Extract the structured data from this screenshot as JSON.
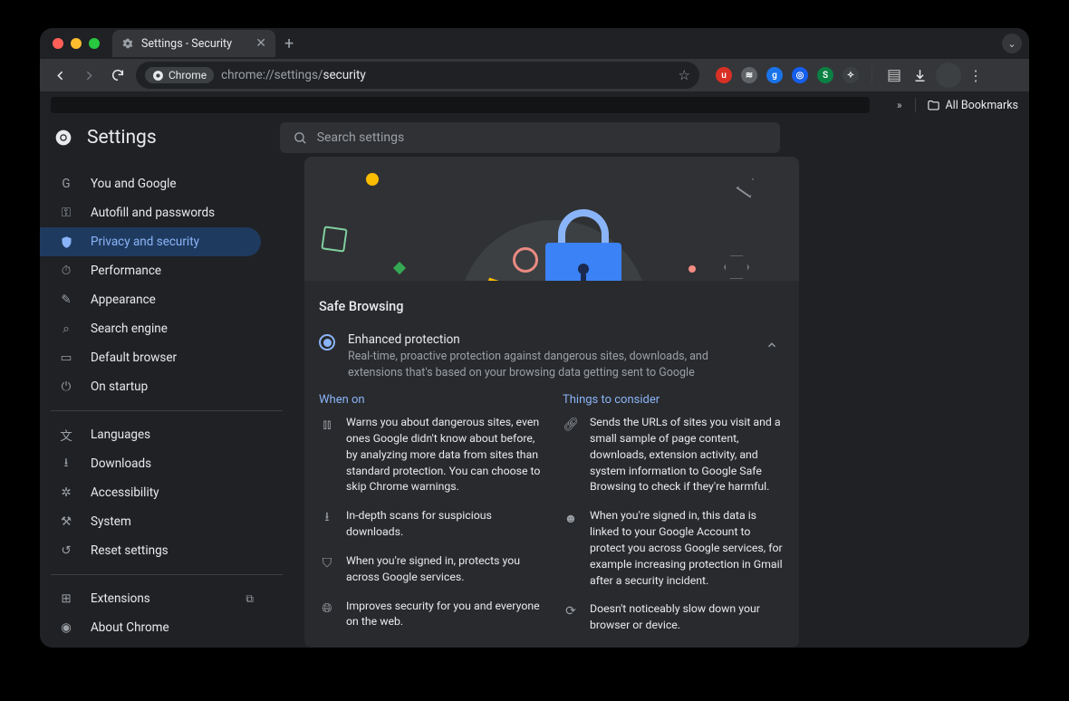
{
  "window": {
    "tab_title": "Settings - Security",
    "url_prefix": "chrome://settings/",
    "url_page": "security",
    "chip_label": "Chrome",
    "bookmarks_label": "All Bookmarks"
  },
  "header": {
    "title": "Settings",
    "search_placeholder": "Search settings"
  },
  "sidebar": {
    "items": [
      {
        "label": "You and Google",
        "icon": "user-icon"
      },
      {
        "label": "Autofill and passwords",
        "icon": "key-icon"
      },
      {
        "label": "Privacy and security",
        "icon": "shield-icon",
        "active": true
      },
      {
        "label": "Performance",
        "icon": "speedometer-icon"
      },
      {
        "label": "Appearance",
        "icon": "paint-icon"
      },
      {
        "label": "Search engine",
        "icon": "search-icon"
      },
      {
        "label": "Default browser",
        "icon": "window-icon"
      },
      {
        "label": "On startup",
        "icon": "power-icon"
      }
    ],
    "items2": [
      {
        "label": "Languages",
        "icon": "translate-icon"
      },
      {
        "label": "Downloads",
        "icon": "download-icon"
      },
      {
        "label": "Accessibility",
        "icon": "accessibility-icon"
      },
      {
        "label": "System",
        "icon": "system-icon"
      },
      {
        "label": "Reset settings",
        "icon": "reset-icon"
      }
    ],
    "items3": [
      {
        "label": "Extensions",
        "icon": "extension-icon",
        "external": true
      },
      {
        "label": "About Chrome",
        "icon": "chrome-icon"
      }
    ]
  },
  "main": {
    "section_title": "Safe Browsing",
    "option": {
      "title": "Enhanced protection",
      "desc": "Real-time, proactive protection against dangerous sites, downloads, and extensions that's based on your browsing data getting sent to Google"
    },
    "col_left_head": "When on",
    "col_right_head": "Things to consider",
    "left": [
      {
        "text": "Warns you about dangerous sites, even ones Google didn't know about before, by analyzing more data from sites than standard protection. You can choose to skip Chrome warnings."
      },
      {
        "text": "In-depth scans for suspicious downloads."
      },
      {
        "text": "When you're signed in, protects you across Google services."
      },
      {
        "text": "Improves security for you and everyone on the web."
      }
    ],
    "right": [
      {
        "text": "Sends the URLs of sites you visit and a small sample of page content, downloads, extension activity, and system information to Google Safe Browsing to check if they're harmful."
      },
      {
        "text": "When you're signed in, this data is linked to your Google Account to protect you across Google services, for example increasing protection in Gmail after a security incident."
      },
      {
        "text": "Doesn't noticeably slow down your browser or device."
      }
    ]
  }
}
